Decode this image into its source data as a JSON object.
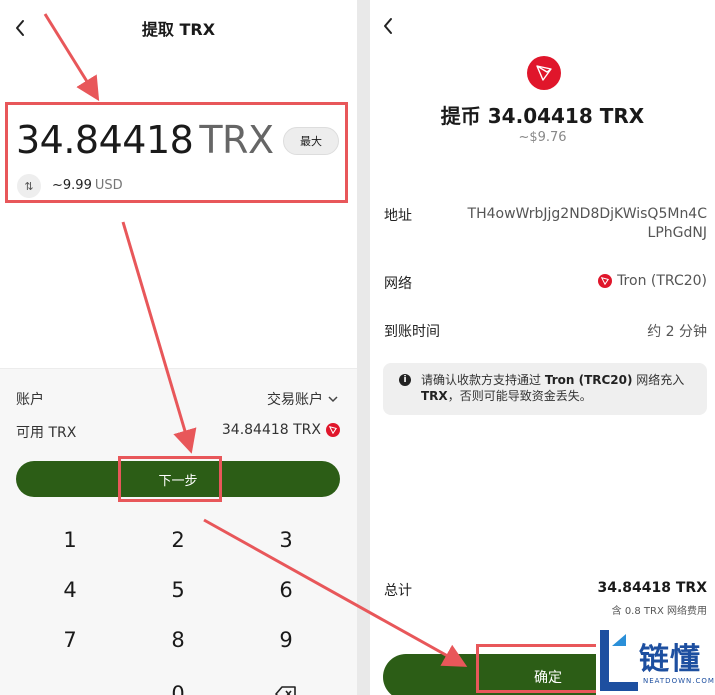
{
  "left": {
    "title": "提取 TRX",
    "amount": "34.84418",
    "amount_unit": "TRX",
    "max_label": "最大",
    "usd_value": "~9.99",
    "usd_unit": "USD",
    "account_label": "账户",
    "account_value": "交易账户",
    "available_label": "可用 TRX",
    "available_value": "34.84418 TRX",
    "next_label": "下一步",
    "keypad": [
      "1",
      "2",
      "3",
      "4",
      "5",
      "6",
      "7",
      "8",
      "9",
      "0"
    ]
  },
  "right": {
    "title": "提币 34.04418 TRX",
    "usd_value": "~$9.76",
    "address_label": "地址",
    "address_value": "TH4owWrbJjg2ND8DjKWisQ5Mn4CLPhGdNJ",
    "network_label": "网络",
    "network_value": "Tron (TRC20)",
    "arrival_label": "到账时间",
    "arrival_value": "约 2 分钟",
    "notice_pre": "请确认收款方支持通过 ",
    "notice_bold1": "Tron (TRC20)",
    "notice_mid": " 网络充入 ",
    "notice_bold2": "TRX",
    "notice_post": "，否则可能导致资金丢失。",
    "total_label": "总计",
    "total_value": "34.84418 TRX",
    "fee_note": "含 0.8 TRX 网络费用",
    "confirm_label": "确定"
  },
  "watermark": {
    "name": "链懂",
    "sub": "NEATDOWN.COM"
  },
  "colors": {
    "primary_green": "#2c5d16",
    "tron_red": "#e0162b",
    "annotation_red": "#e8575a",
    "watermark_blue": "#1d4fa0"
  },
  "icons": {
    "back": "chevron-left-icon",
    "swap": "swap-arrows-icon",
    "dropdown": "chevron-down-icon",
    "tron": "tron-logo-icon",
    "info": "info-icon",
    "backspace": "backspace-icon"
  }
}
